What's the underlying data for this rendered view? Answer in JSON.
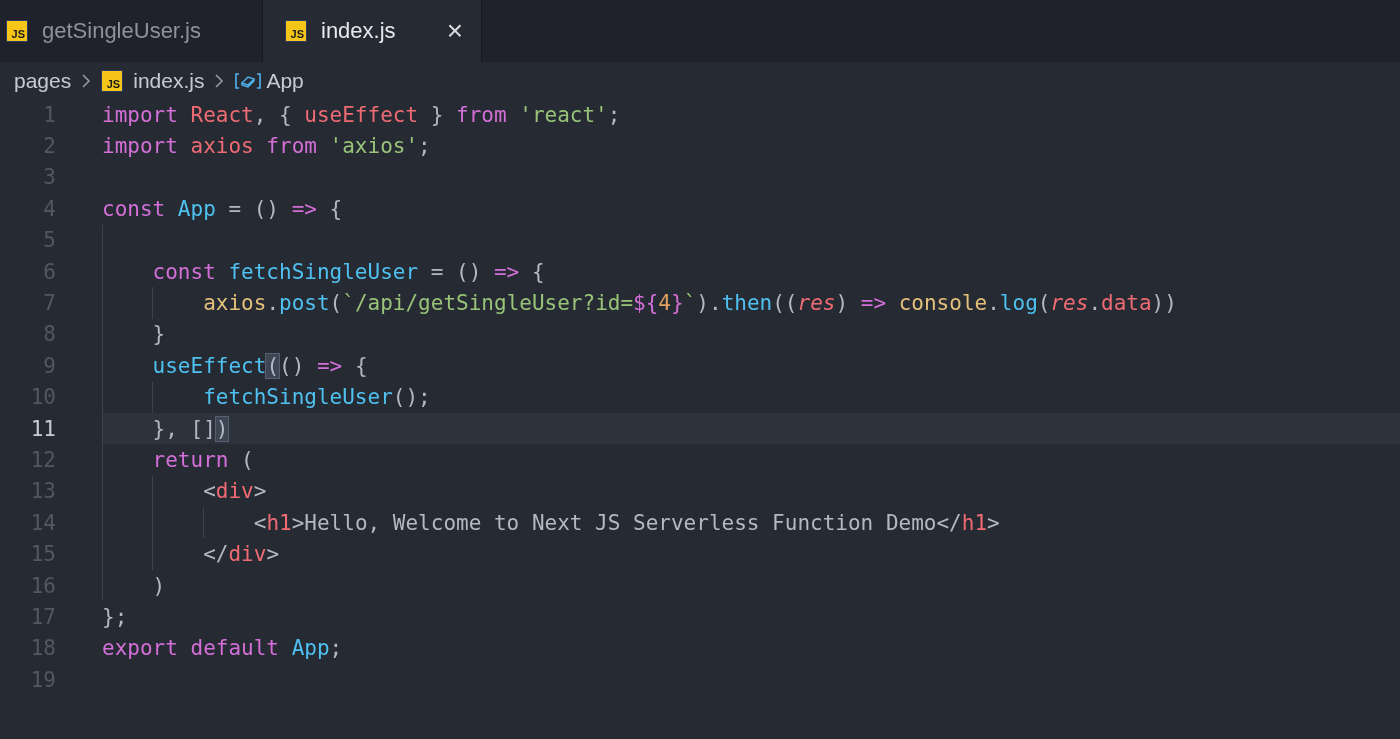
{
  "tabs": [
    {
      "label": "getSingleUser.js",
      "badge": "JS",
      "selected": false
    },
    {
      "label": "index.js",
      "badge": "JS",
      "selected": true,
      "close": "×"
    }
  ],
  "breadcrumb": [
    {
      "kind": "folder",
      "label": "pages"
    },
    {
      "kind": "file",
      "label": "index.js",
      "badge": "JS"
    },
    {
      "kind": "symbol",
      "label": "App"
    }
  ],
  "editor": {
    "lines": [
      {
        "number": "1",
        "current": false,
        "tokens": [
          {
            "kind": "keyword",
            "text": "import"
          },
          {
            "kind": "variable",
            "text": " React"
          },
          {
            "kind": "punct",
            "text": ", { "
          },
          {
            "kind": "variable",
            "text": "useEffect"
          },
          {
            "kind": "punct",
            "text": " } "
          },
          {
            "kind": "keyword",
            "text": "from"
          },
          {
            "kind": "string",
            "text": " 'react'"
          },
          {
            "kind": "punct",
            "text": ";"
          }
        ]
      },
      {
        "number": "2",
        "current": false,
        "tokens": [
          {
            "kind": "keyword",
            "text": "import"
          },
          {
            "kind": "variable",
            "text": " axios"
          },
          {
            "kind": "keyword",
            "text": " from"
          },
          {
            "kind": "string",
            "text": " 'axios'"
          },
          {
            "kind": "punct",
            "text": ";"
          }
        ]
      },
      {
        "number": "3",
        "current": false
      },
      {
        "number": "4",
        "current": false,
        "tokens": [
          {
            "kind": "keyword",
            "text": "const"
          },
          {
            "kind": "function",
            "text": " App"
          },
          {
            "kind": "punct",
            "text": " = () "
          },
          {
            "kind": "keyword",
            "text": "=>"
          },
          {
            "kind": "punct",
            "text": " {"
          }
        ]
      },
      {
        "number": "5",
        "current": false
      },
      {
        "number": "6",
        "current": false,
        "tokens": [
          {
            "kind": "keyword",
            "text": "    const"
          },
          {
            "kind": "function",
            "text": " fetchSingleUser"
          },
          {
            "kind": "punct",
            "text": " = () "
          },
          {
            "kind": "keyword",
            "text": "=>"
          },
          {
            "kind": "punct",
            "text": " {"
          }
        ]
      },
      {
        "number": "7",
        "current": false,
        "tokens": [
          {
            "kind": "object",
            "text": "        axios"
          },
          {
            "kind": "punct",
            "text": "."
          },
          {
            "kind": "function",
            "text": "post"
          },
          {
            "kind": "punct",
            "text": "("
          },
          {
            "kind": "string",
            "text": "`/api/getSingleUser?id="
          },
          {
            "kind": "keyword",
            "text": "${"
          },
          {
            "kind": "number",
            "text": "4"
          },
          {
            "kind": "keyword",
            "text": "}"
          },
          {
            "kind": "string",
            "text": "`"
          },
          {
            "kind": "punct",
            "text": ")."
          },
          {
            "kind": "function",
            "text": "then"
          },
          {
            "kind": "punct",
            "text": "(("
          },
          {
            "kind": "param",
            "text": "res"
          },
          {
            "kind": "punct",
            "text": ") "
          },
          {
            "kind": "keyword",
            "text": "=>"
          },
          {
            "kind": "object",
            "text": " console"
          },
          {
            "kind": "punct",
            "text": "."
          },
          {
            "kind": "function",
            "text": "log"
          },
          {
            "kind": "punct",
            "text": "("
          },
          {
            "kind": "param",
            "text": "res"
          },
          {
            "kind": "punct",
            "text": "."
          },
          {
            "kind": "variable",
            "text": "data"
          },
          {
            "kind": "punct",
            "text": "))"
          }
        ]
      },
      {
        "number": "8",
        "current": false,
        "tokens": [
          {
            "kind": "punct",
            "text": "    }"
          }
        ]
      },
      {
        "number": "9",
        "current": false,
        "tokens": [
          {
            "kind": "function",
            "text": "    useEffect"
          },
          {
            "kind": "match",
            "text": "("
          },
          {
            "kind": "punct",
            "text": "() "
          },
          {
            "kind": "keyword",
            "text": "=>"
          },
          {
            "kind": "punct",
            "text": " {"
          }
        ]
      },
      {
        "number": "10",
        "current": false,
        "tokens": [
          {
            "kind": "function",
            "text": "        fetchSingleUser"
          },
          {
            "kind": "punct",
            "text": "();"
          }
        ]
      },
      {
        "number": "11",
        "current": true,
        "tokens": [
          {
            "kind": "punct",
            "text": "    }, []"
          },
          {
            "kind": "match",
            "text": ")"
          }
        ]
      },
      {
        "number": "12",
        "current": false,
        "tokens": [
          {
            "kind": "keyword",
            "text": "    return"
          },
          {
            "kind": "punct",
            "text": " ("
          }
        ]
      },
      {
        "number": "13",
        "current": false,
        "tokens": [
          {
            "kind": "punct",
            "text": "        <"
          },
          {
            "kind": "variable",
            "text": "div"
          },
          {
            "kind": "punct",
            "text": ">"
          }
        ]
      },
      {
        "number": "14",
        "current": false,
        "tokens": [
          {
            "kind": "punct",
            "text": "            <"
          },
          {
            "kind": "variable",
            "text": "h1"
          },
          {
            "kind": "punct",
            "text": ">Hello, Welcome to Next JS Serverless Function Demo</"
          },
          {
            "kind": "variable",
            "text": "h1"
          },
          {
            "kind": "punct",
            "text": ">"
          }
        ]
      },
      {
        "number": "15",
        "current": false,
        "tokens": [
          {
            "kind": "punct",
            "text": "        </"
          },
          {
            "kind": "variable",
            "text": "div"
          },
          {
            "kind": "punct",
            "text": ">"
          }
        ]
      },
      {
        "number": "16",
        "current": false,
        "tokens": [
          {
            "kind": "punct",
            "text": "    )"
          }
        ]
      },
      {
        "number": "17",
        "current": false,
        "tokens": [
          {
            "kind": "punct",
            "text": "};"
          }
        ]
      },
      {
        "number": "18",
        "current": false,
        "tokens": [
          {
            "kind": "keyword",
            "text": "export"
          },
          {
            "kind": "keyword",
            "text": " default"
          },
          {
            "kind": "function",
            "text": " App"
          },
          {
            "kind": "punct",
            "text": ";"
          }
        ]
      },
      {
        "number": "19",
        "current": false
      }
    ]
  }
}
